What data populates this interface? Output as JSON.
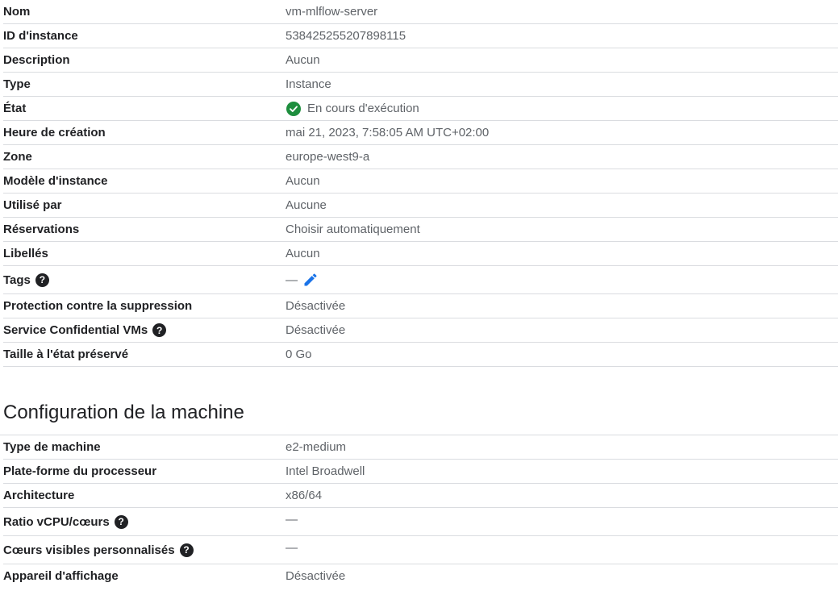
{
  "details": {
    "name_label": "Nom",
    "name_value": "vm-mlflow-server",
    "id_label": "ID d'instance",
    "id_value": "538425255207898115",
    "description_label": "Description",
    "description_value": "Aucun",
    "type_label": "Type",
    "type_value": "Instance",
    "state_label": "État",
    "state_value": "En cours d'exécution",
    "creation_label": "Heure de création",
    "creation_value": "mai 21, 2023, 7:58:05 AM UTC+02:00",
    "zone_label": "Zone",
    "zone_value": "europe-west9-a",
    "template_label": "Modèle d'instance",
    "template_value": "Aucun",
    "used_by_label": "Utilisé par",
    "used_by_value": "Aucune",
    "reservations_label": "Réservations",
    "reservations_value": "Choisir automatiquement",
    "labels_label": "Libellés",
    "labels_value": "Aucun",
    "tags_label": "Tags",
    "tags_value": "—",
    "deletion_protection_label": "Protection contre la suppression",
    "deletion_protection_value": "Désactivée",
    "confidential_label": "Service Confidential VMs",
    "confidential_value": "Désactivée",
    "preserved_state_label": "Taille à l'état préservé",
    "preserved_state_value": "0 Go"
  },
  "machine": {
    "section_title": "Configuration de la machine",
    "machine_type_label": "Type de machine",
    "machine_type_value": "e2-medium",
    "cpu_platform_label": "Plate-forme du processeur",
    "cpu_platform_value": "Intel Broadwell",
    "architecture_label": "Architecture",
    "architecture_value": "x86/64",
    "vcpu_ratio_label": "Ratio vCPU/cœurs",
    "vcpu_ratio_value": "—",
    "visible_cores_label": "Cœurs visibles personnalisés",
    "visible_cores_value": "—",
    "display_device_label": "Appareil d'affichage",
    "display_device_value": "Désactivée"
  },
  "icons": {
    "help": "help-circle-icon",
    "status": "check-circle-icon",
    "edit": "pencil-icon"
  },
  "colors": {
    "status_green": "#1e8e3e",
    "edit_blue": "#1a73e8"
  }
}
